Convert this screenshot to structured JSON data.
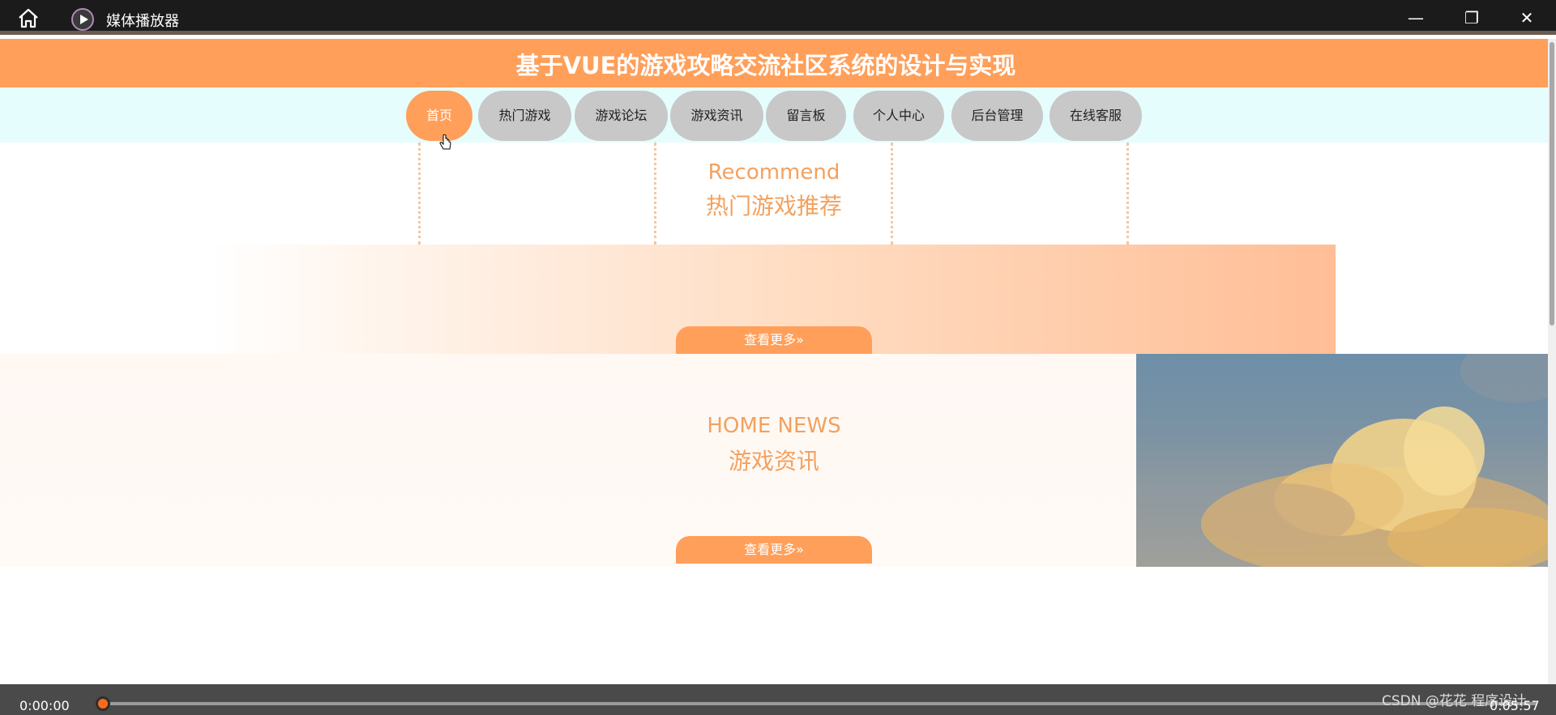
{
  "window": {
    "title": "媒体播放器",
    "controls": {
      "minimize": "—",
      "maximize": "❐",
      "close": "✕"
    }
  },
  "site": {
    "title": "基于VUE的游戏攻略交流社区系统的设计与实现",
    "accent_color": "#ff9f5a"
  },
  "nav": {
    "items": [
      {
        "label": "首页",
        "active": true
      },
      {
        "label": "热门游戏",
        "active": false
      },
      {
        "label": "游戏论坛",
        "active": false
      },
      {
        "label": "游戏资讯",
        "active": false
      },
      {
        "label": "留言板",
        "active": false
      },
      {
        "label": "个人中心",
        "active": false
      },
      {
        "label": "后台管理",
        "active": false
      },
      {
        "label": "在线客服",
        "active": false
      }
    ]
  },
  "sections": {
    "recommend": {
      "en": "Recommend",
      "cn": "热门游戏推荐",
      "more_label": "查看更多»"
    },
    "news": {
      "en": "HOME NEWS",
      "cn": "游戏资讯",
      "more_label": "查看更多»"
    }
  },
  "player": {
    "current_time": "0:00:00",
    "total_time": "0:05:57",
    "progress": 0.0,
    "watermark": "CSDN @花花 程序设计"
  },
  "icons": {
    "home": "home-icon",
    "app": "play-circle-icon",
    "cursor": "hand-cursor-icon"
  }
}
